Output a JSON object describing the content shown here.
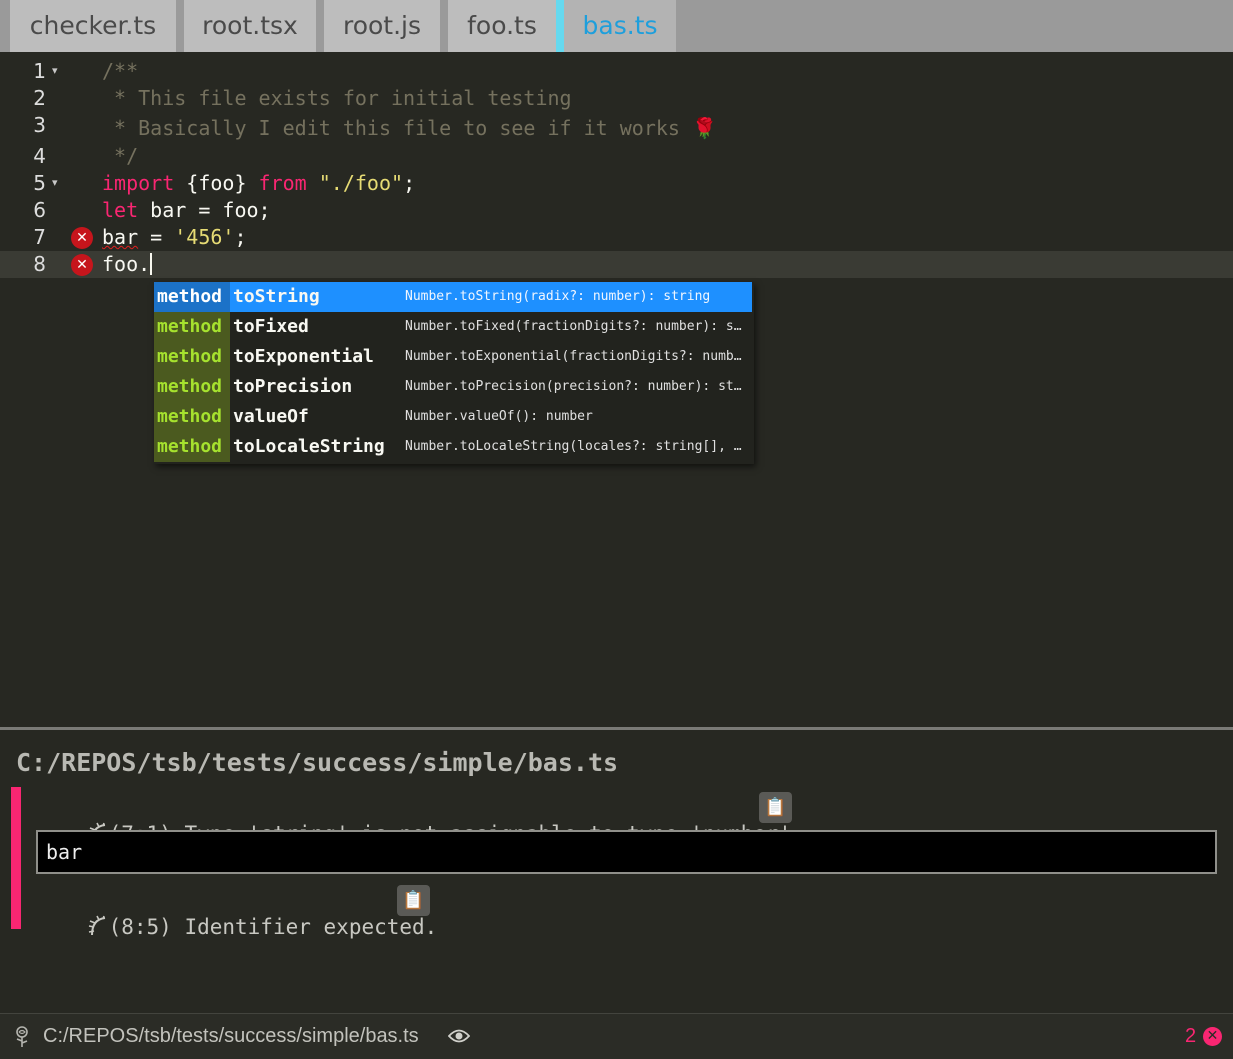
{
  "tabs": [
    {
      "label": "checker.ts"
    },
    {
      "label": "root.tsx"
    },
    {
      "label": "root.js"
    },
    {
      "label": "foo.ts"
    },
    {
      "label": "bas.ts",
      "active": true
    }
  ],
  "editor": {
    "lines": [
      {
        "num": "1",
        "folded": "▾"
      },
      {
        "num": "2"
      },
      {
        "num": "3"
      },
      {
        "num": "4"
      },
      {
        "num": "5",
        "folded": "▾"
      },
      {
        "num": "6"
      },
      {
        "num": "7",
        "error": "✕"
      },
      {
        "num": "8",
        "error": "✕"
      }
    ],
    "code": {
      "l1": "/**",
      "l2": " * This file exists for initial testing",
      "l3": " * Basically I edit this file to see if it works 🌹",
      "l4": " */",
      "l5_kw1": "import",
      "l5_mid": " {foo} ",
      "l5_kw2": "from",
      "l5_sp": " ",
      "l5_str": "\"./foo\"",
      "l5_end": ";",
      "l6_kw": "let",
      "l6_rest": " bar = foo;",
      "l7_var": "bar",
      "l7_mid": " = ",
      "l7_str": "'456'",
      "l7_end": ";",
      "l8": "foo."
    }
  },
  "completion": {
    "items": [
      {
        "kind": "method",
        "name": "toString",
        "signature": "Number.toString(radix?: number): string"
      },
      {
        "kind": "method",
        "name": "toFixed",
        "signature": "Number.toFixed(fractionDigits?: number): st…"
      },
      {
        "kind": "method",
        "name": "toExponential",
        "signature": "Number.toExponential(fractionDigits?: numbe…"
      },
      {
        "kind": "method",
        "name": "toPrecision",
        "signature": "Number.toPrecision(precision?: number): str…"
      },
      {
        "kind": "method",
        "name": "valueOf",
        "signature": "Number.valueOf(): number"
      },
      {
        "kind": "method",
        "name": "toLocaleString",
        "signature": "Number.toLocaleString(locales?: string[], o…"
      }
    ]
  },
  "panel": {
    "path": "C:/REPOS/tsb/tests/success/simple/bas.ts",
    "errors": [
      {
        "location": "(7:1)",
        "message": "Type 'string' is not assignable to type 'number'.",
        "snippet": "bar"
      },
      {
        "location": "(8:5)",
        "message": "Identifier expected."
      }
    ],
    "copy_icon": "clipboard-icon",
    "bug_icon": "bug-icon"
  },
  "status": {
    "path": "C:/REPOS/tsb/tests/success/simple/bas.ts",
    "error_count": "2",
    "error_icon": "✕"
  },
  "colors": {
    "background": "#272822",
    "keyword": "#f92672",
    "string": "#e6db74",
    "comment": "#75715e",
    "selection": "#1e90ff",
    "method_kind": "#a6e22e",
    "active_tab_accent": "#66d9ef",
    "error_red": "#c6151c"
  }
}
